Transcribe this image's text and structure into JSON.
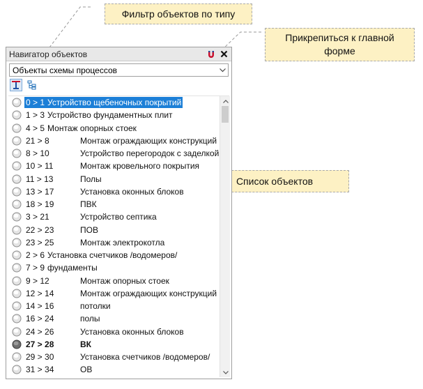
{
  "callouts": {
    "filter": "Фильтр объектов по типу",
    "pin": "Прикрепиться к главной форме",
    "list": "Список объектов"
  },
  "panel": {
    "title": "Навигатор объектов",
    "pin_icon": "magnet-icon",
    "close_icon": "close-icon",
    "filter_value": "Объекты схемы процессов",
    "toolbar": [
      "tree-flat-icon",
      "tree-hierarchy-icon"
    ],
    "scroll_position": 0.02,
    "items": [
      {
        "code": "0 > 1",
        "label": "Устройство щебеночных покрытий",
        "state": "selected",
        "wide": false
      },
      {
        "code": "1 > 3",
        "label": "Устройство фундаментных плит",
        "state": "normal",
        "wide": false
      },
      {
        "code": "4 > 5",
        "label": "Монтаж опорных стоек",
        "state": "normal",
        "wide": false
      },
      {
        "code": "21 > 8",
        "label": "Монтаж ограждающих конструкций",
        "state": "normal",
        "wide": true
      },
      {
        "code": "8 > 10",
        "label": "Устройство перегородок с заделкой",
        "state": "normal",
        "wide": true
      },
      {
        "code": "10 > 11",
        "label": "Монтаж кровельного покрытия",
        "state": "normal",
        "wide": true
      },
      {
        "code": "11 > 13",
        "label": "Полы",
        "state": "normal",
        "wide": true
      },
      {
        "code": "13 > 17",
        "label": "Установка оконных блоков",
        "state": "normal",
        "wide": true
      },
      {
        "code": "18 > 19",
        "label": "ПВК",
        "state": "normal",
        "wide": true
      },
      {
        "code": "3 > 21",
        "label": "Устройство септика",
        "state": "normal",
        "wide": true
      },
      {
        "code": "22 > 23",
        "label": "ПОВ",
        "state": "normal",
        "wide": true
      },
      {
        "code": "23 > 25",
        "label": "Монтаж электрокотла",
        "state": "normal",
        "wide": true
      },
      {
        "code": "2 > 6",
        "label": "Установка счетчиков /водомеров/",
        "state": "normal",
        "wide": false
      },
      {
        "code": "7 > 9",
        "label": "фундаменты",
        "state": "normal",
        "wide": false
      },
      {
        "code": "9 > 12",
        "label": "Монтаж опорных стоек",
        "state": "normal",
        "wide": true
      },
      {
        "code": "12 > 14",
        "label": "Монтаж ограждающих конструкций",
        "state": "normal",
        "wide": true
      },
      {
        "code": "14 > 16",
        "label": "потолки",
        "state": "normal",
        "wide": true
      },
      {
        "code": "16 > 24",
        "label": "полы",
        "state": "normal",
        "wide": true
      },
      {
        "code": "24 > 26",
        "label": "Установка оконных блоков",
        "state": "normal",
        "wide": true
      },
      {
        "code": "27 > 28",
        "label": "ВК",
        "state": "bold",
        "wide": true
      },
      {
        "code": "29 > 30",
        "label": "Установка счетчиков /водомеров/",
        "state": "normal",
        "wide": true
      },
      {
        "code": "31 > 34",
        "label": "ОВ",
        "state": "normal",
        "wide": true
      }
    ]
  },
  "colors": {
    "selection": "#1c7fd7",
    "callout_bg": "#fdf1c4"
  }
}
